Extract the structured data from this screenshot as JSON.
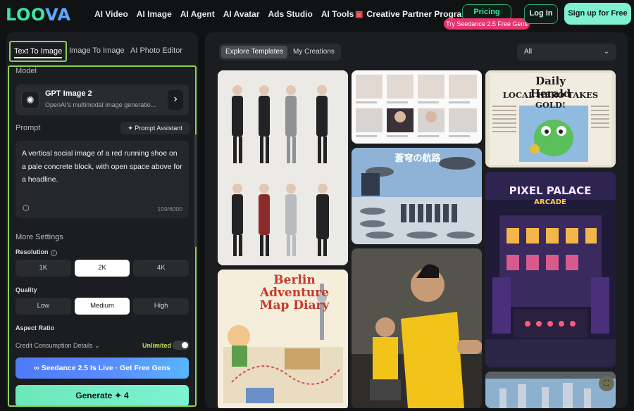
{
  "brand": {
    "logo_text": "LOOVA",
    "logo_main": "LOO",
    "logo_accent": "VA"
  },
  "nav": {
    "items": [
      "AI Video",
      "AI Image",
      "AI Agent",
      "AI Avatar",
      "Ads Studio",
      "AI Tools"
    ],
    "partner_label": "Creative Partner Program",
    "pricing_label": "Pricing",
    "promo_badge": "Try Seedance 2.5 Free Gens",
    "login_label": "Log In",
    "signup_label": "Sign up for Free"
  },
  "left_panel": {
    "tabs": [
      "Text To Image",
      "Image To Image",
      "AI Photo Editor"
    ],
    "active_tab": "Text To Image",
    "model_section_label": "Model",
    "model": {
      "name": "GPT Image 2",
      "description": "OpenAI's multimodal image generatio..."
    },
    "prompt_label": "Prompt",
    "prompt_assistant_label": "Prompt Assistant",
    "prompt_text": "A vertical social image of a red running shoe on a pale concrete block, with open space above for a headline.",
    "char_counter": "109/6000",
    "more_settings_label": "More Settings",
    "resolution": {
      "label": "Resolution",
      "options": [
        "1K",
        "2K",
        "4K"
      ],
      "selected": "2K"
    },
    "quality": {
      "label": "Quality",
      "options": [
        "Low",
        "Medium",
        "High"
      ],
      "selected": "Medium"
    },
    "aspect_ratio_label": "Aspect Ratio",
    "credit_label": "Credit Consumption Details",
    "unlimited_label": "Unlimited",
    "unlimited_enabled": false,
    "seedance_button_label": "Seedance 2.5 Is Live · Get Free Gens",
    "generate_label": "Generate",
    "generate_cost": "4"
  },
  "gallery": {
    "tabs": [
      "Explore Templates",
      "My Creations"
    ],
    "active_tab": "Explore Templates",
    "filter_value": "All",
    "cards": [
      {
        "name": "character-sheet-card",
        "caption": ""
      },
      {
        "name": "product-grid-card",
        "caption": ""
      },
      {
        "name": "newspaper-card",
        "caption": "Daily Herald",
        "subcaption": "LOCAL HERO TAKES GOLD!"
      },
      {
        "name": "airship-card",
        "caption": "蒼穹の航路"
      },
      {
        "name": "pixel-palace-card",
        "caption": "PIXEL PALACE",
        "subcaption": "ARCADE"
      },
      {
        "name": "berlin-map-card",
        "caption": "Berlin Adventure Map Diary"
      },
      {
        "name": "martial-artist-card",
        "caption": ""
      },
      {
        "name": "fantasy-castle-card",
        "caption": ""
      }
    ]
  },
  "colors": {
    "accent_green": "#3de3a3",
    "highlight_border": "#8bd35a",
    "promo_pink": "#e8356f",
    "seedance_blue": "#5b8cff",
    "generate_mint": "#7cf3d3"
  }
}
